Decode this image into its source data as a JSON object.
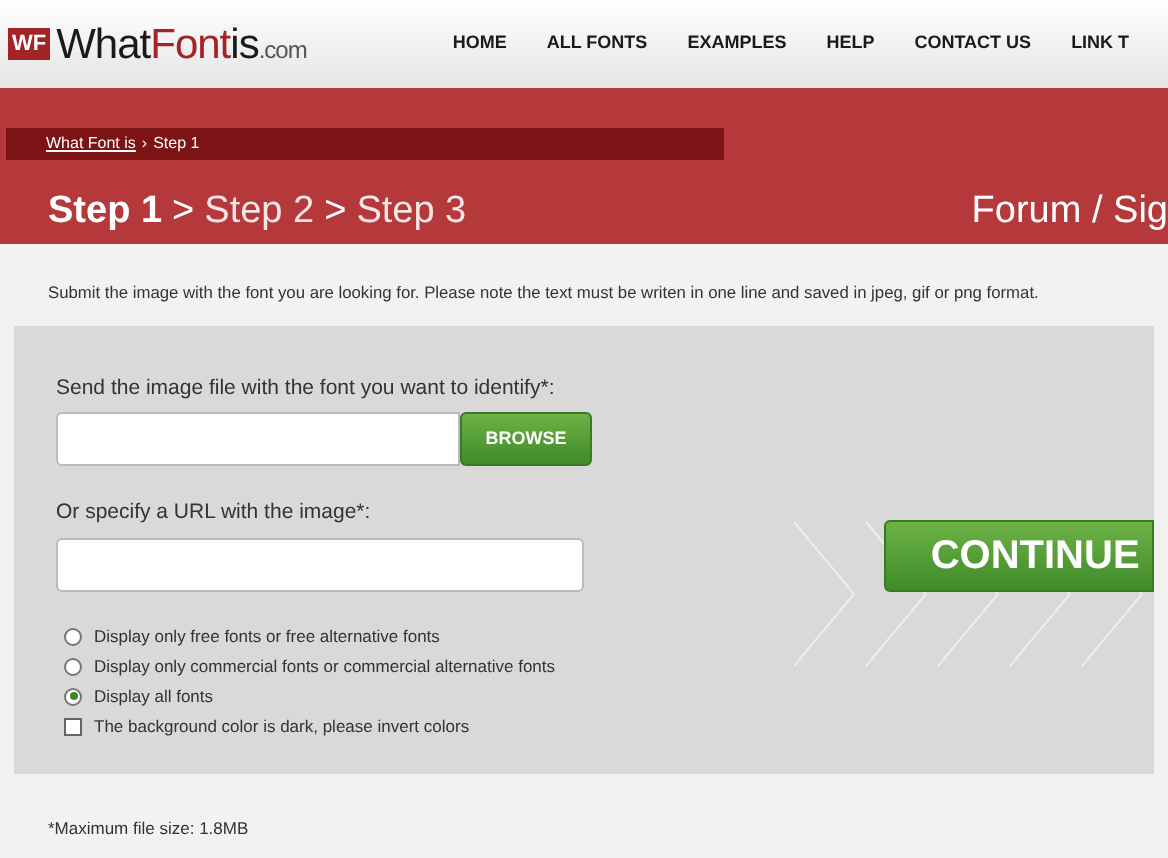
{
  "logo": {
    "badge": "WF",
    "parts": [
      {
        "text": "What",
        "accent": false
      },
      {
        "text": "Font",
        "accent": true
      },
      {
        "text": "is",
        "accent": false
      }
    ],
    "suffix": ".com"
  },
  "nav": [
    "HOME",
    "ALL FONTS",
    "EXAMPLES",
    "HELP",
    "CONTACT US",
    "LINK T"
  ],
  "breadcrumb": {
    "link": "What Font is",
    "separator": "›",
    "current": "Step 1"
  },
  "steps": [
    {
      "label": "Step 1",
      "selected": true
    },
    {
      "label": "Step 2",
      "selected": false
    },
    {
      "label": "Step 3",
      "selected": false
    }
  ],
  "step_separator": ">",
  "banner_right": "Forum / Sig",
  "intro": "Submit the image with the font you are looking for. Please note the text must be writen in one line and saved in jpeg, gif or png format.",
  "form": {
    "file_label": "Send the image file with the font you want to identify*:",
    "browse": "BROWSE",
    "url_label": "Or specify a URL with the image*:",
    "continue": "CONTINUE",
    "options": [
      {
        "kind": "radio",
        "label": "Display only free fonts or free alternative fonts",
        "selected": false
      },
      {
        "kind": "radio",
        "label": "Display only commercial fonts or commercial alternative fonts",
        "selected": false
      },
      {
        "kind": "radio",
        "label": "Display all fonts",
        "selected": true
      },
      {
        "kind": "checkbox",
        "label": "The background color is dark, please invert colors",
        "checked": false
      }
    ]
  },
  "footnote": "*Maximum file size: 1.8MB"
}
